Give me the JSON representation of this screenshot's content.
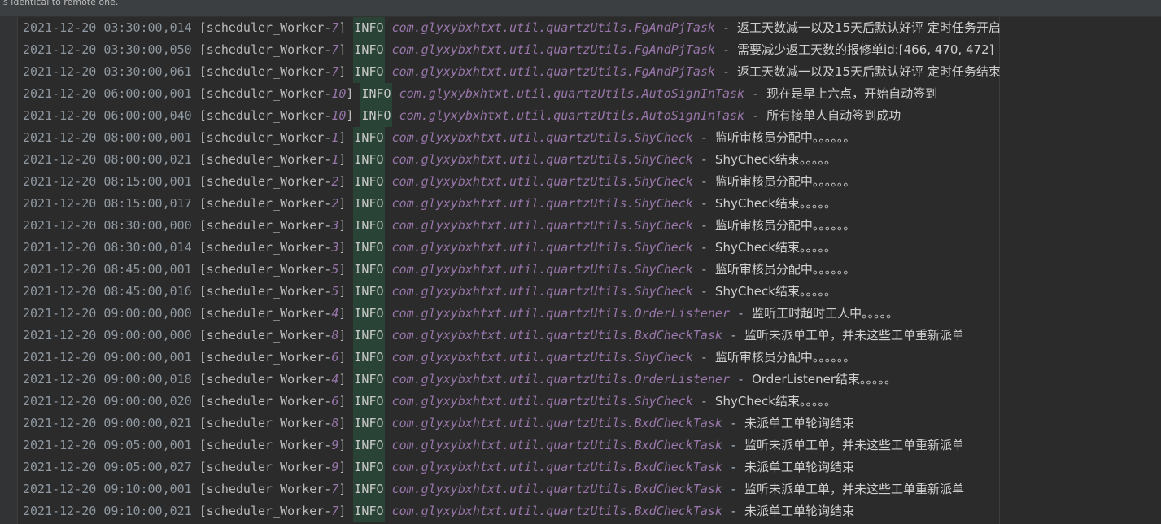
{
  "banner": {
    "text": "is identical to remote one."
  },
  "rows": [
    {
      "ts": "2021-12-20 03:30:00,014",
      "thread": "[scheduler_Worker-7]",
      "level": "INFO",
      "logger": "com.glyxybxhtxt.util.quartzUtils.FgAndPjTask",
      "msg": "返工天数减一以及15天后默认好评 定时任务开启"
    },
    {
      "ts": "2021-12-20 03:30:00,050",
      "thread": "[scheduler_Worker-7]",
      "level": "INFO",
      "logger": "com.glyxybxhtxt.util.quartzUtils.FgAndPjTask",
      "msg": "需要减少返工天数的报修单id:[466, 470, 472]"
    },
    {
      "ts": "2021-12-20 03:30:00,061",
      "thread": "[scheduler_Worker-7]",
      "level": "INFO",
      "logger": "com.glyxybxhtxt.util.quartzUtils.FgAndPjTask",
      "msg": "返工天数减一以及15天后默认好评 定时任务结束"
    },
    {
      "ts": "2021-12-20 06:00:00,001",
      "thread": "[scheduler_Worker-10]",
      "level": "INFO",
      "logger": "com.glyxybxhtxt.util.quartzUtils.AutoSignInTask",
      "msg": "现在是早上六点，开始自动签到"
    },
    {
      "ts": "2021-12-20 06:00:00,040",
      "thread": "[scheduler_Worker-10]",
      "level": "INFO",
      "logger": "com.glyxybxhtxt.util.quartzUtils.AutoSignInTask",
      "msg": "所有接单人自动签到成功"
    },
    {
      "ts": "2021-12-20 08:00:00,001",
      "thread": "[scheduler_Worker-1]",
      "level": "INFO",
      "logger": "com.glyxybxhtxt.util.quartzUtils.ShyCheck",
      "msg": "监听审核员分配中。。。。。。"
    },
    {
      "ts": "2021-12-20 08:00:00,021",
      "thread": "[scheduler_Worker-1]",
      "level": "INFO",
      "logger": "com.glyxybxhtxt.util.quartzUtils.ShyCheck",
      "msg": "ShyCheck结束。。。。。"
    },
    {
      "ts": "2021-12-20 08:15:00,001",
      "thread": "[scheduler_Worker-2]",
      "level": "INFO",
      "logger": "com.glyxybxhtxt.util.quartzUtils.ShyCheck",
      "msg": "监听审核员分配中。。。。。。"
    },
    {
      "ts": "2021-12-20 08:15:00,017",
      "thread": "[scheduler_Worker-2]",
      "level": "INFO",
      "logger": "com.glyxybxhtxt.util.quartzUtils.ShyCheck",
      "msg": "ShyCheck结束。。。。。"
    },
    {
      "ts": "2021-12-20 08:30:00,000",
      "thread": "[scheduler_Worker-3]",
      "level": "INFO",
      "logger": "com.glyxybxhtxt.util.quartzUtils.ShyCheck",
      "msg": "监听审核员分配中。。。。。。"
    },
    {
      "ts": "2021-12-20 08:30:00,014",
      "thread": "[scheduler_Worker-3]",
      "level": "INFO",
      "logger": "com.glyxybxhtxt.util.quartzUtils.ShyCheck",
      "msg": "ShyCheck结束。。。。。"
    },
    {
      "ts": "2021-12-20 08:45:00,001",
      "thread": "[scheduler_Worker-5]",
      "level": "INFO",
      "logger": "com.glyxybxhtxt.util.quartzUtils.ShyCheck",
      "msg": "监听审核员分配中。。。。。。"
    },
    {
      "ts": "2021-12-20 08:45:00,016",
      "thread": "[scheduler_Worker-5]",
      "level": "INFO",
      "logger": "com.glyxybxhtxt.util.quartzUtils.ShyCheck",
      "msg": "ShyCheck结束。。。。。"
    },
    {
      "ts": "2021-12-20 09:00:00,000",
      "thread": "[scheduler_Worker-4]",
      "level": "INFO",
      "logger": "com.glyxybxhtxt.util.quartzUtils.OrderListener",
      "msg": "监听工时超时工人中。。。。。"
    },
    {
      "ts": "2021-12-20 09:00:00,000",
      "thread": "[scheduler_Worker-8]",
      "level": "INFO",
      "logger": "com.glyxybxhtxt.util.quartzUtils.BxdCheckTask",
      "msg": "监听未派单工单，并未这些工单重新派单"
    },
    {
      "ts": "2021-12-20 09:00:00,001",
      "thread": "[scheduler_Worker-6]",
      "level": "INFO",
      "logger": "com.glyxybxhtxt.util.quartzUtils.ShyCheck",
      "msg": "监听审核员分配中。。。。。。"
    },
    {
      "ts": "2021-12-20 09:00:00,018",
      "thread": "[scheduler_Worker-4]",
      "level": "INFO",
      "logger": "com.glyxybxhtxt.util.quartzUtils.OrderListener",
      "msg": "OrderListener结束。。。。。"
    },
    {
      "ts": "2021-12-20 09:00:00,020",
      "thread": "[scheduler_Worker-6]",
      "level": "INFO",
      "logger": "com.glyxybxhtxt.util.quartzUtils.ShyCheck",
      "msg": "ShyCheck结束。。。。。"
    },
    {
      "ts": "2021-12-20 09:00:00,021",
      "thread": "[scheduler_Worker-8]",
      "level": "INFO",
      "logger": "com.glyxybxhtxt.util.quartzUtils.BxdCheckTask",
      "msg": "未派单工单轮询结束"
    },
    {
      "ts": "2021-12-20 09:05:00,001",
      "thread": "[scheduler_Worker-9]",
      "level": "INFO",
      "logger": "com.glyxybxhtxt.util.quartzUtils.BxdCheckTask",
      "msg": "监听未派单工单，并未这些工单重新派单"
    },
    {
      "ts": "2021-12-20 09:05:00,027",
      "thread": "[scheduler_Worker-9]",
      "level": "INFO",
      "logger": "com.glyxybxhtxt.util.quartzUtils.BxdCheckTask",
      "msg": "未派单工单轮询结束"
    },
    {
      "ts": "2021-12-20 09:10:00,001",
      "thread": "[scheduler_Worker-7]",
      "level": "INFO",
      "logger": "com.glyxybxhtxt.util.quartzUtils.BxdCheckTask",
      "msg": "监听未派单工单，并未这些工单重新派单"
    },
    {
      "ts": "2021-12-20 09:10:00,021",
      "thread": "[scheduler_Worker-7]",
      "level": "INFO",
      "logger": "com.glyxybxhtxt.util.quartzUtils.BxdCheckTask",
      "msg": "未派单工单轮询结束"
    }
  ],
  "separator": "-",
  "colors": {
    "background": "#2b2b2b",
    "level_bg": "#294436",
    "logger": "#9876aa"
  }
}
